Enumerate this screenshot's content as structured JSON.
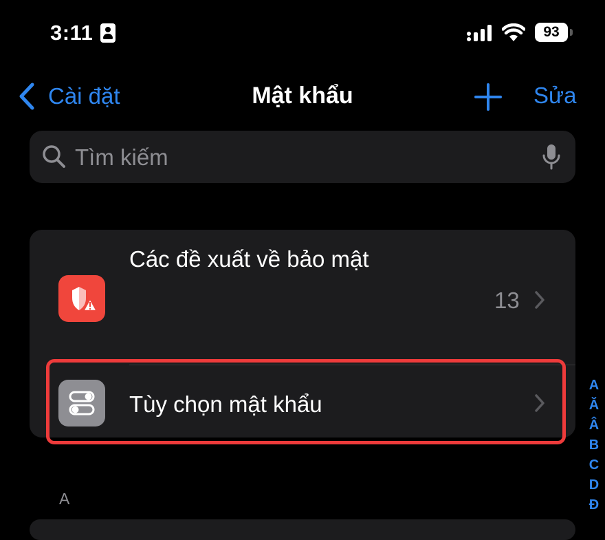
{
  "status_bar": {
    "time": "3:11",
    "battery": "93"
  },
  "nav": {
    "back_label": "Cài đặt",
    "title": "Mật khẩu",
    "edit_label": "Sửa"
  },
  "search": {
    "placeholder": "Tìm kiếm"
  },
  "security_row": {
    "label": "Các đề xuất về bảo mật",
    "count": "13"
  },
  "options_row": {
    "label": "Tùy chọn mật khẩu"
  },
  "section_header": "A",
  "index_letters": [
    "A",
    "Ă",
    "Â",
    "B",
    "C",
    "D",
    "Đ"
  ],
  "colors": {
    "accent": "#2f86ef",
    "security_icon": "#f0463c",
    "highlight": "#ee3b3b"
  }
}
